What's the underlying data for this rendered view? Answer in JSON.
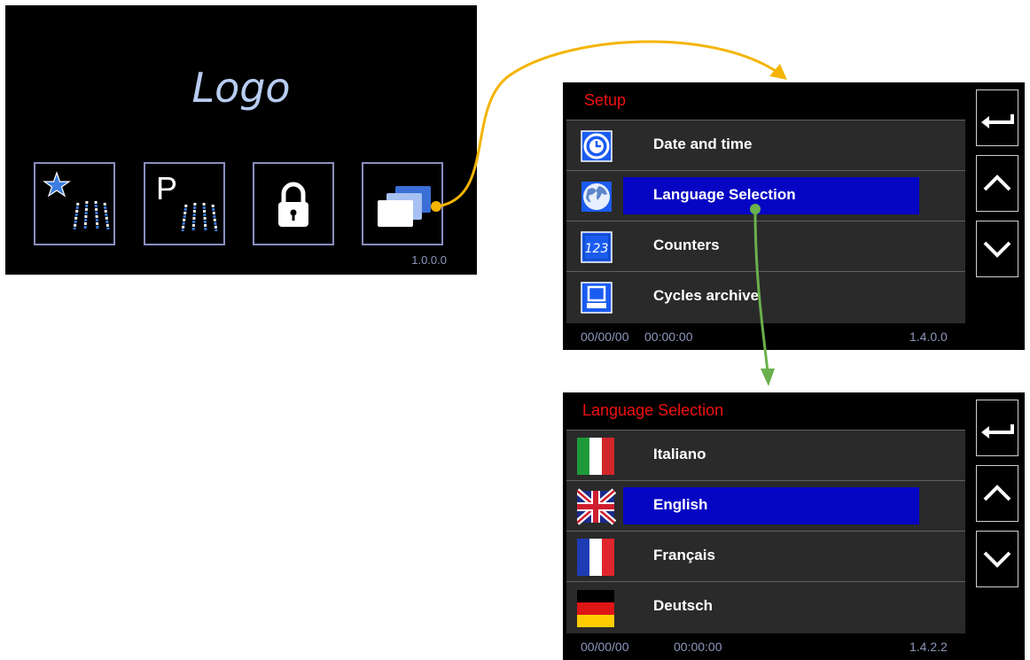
{
  "home": {
    "logo": "Logo",
    "version": "1.0.0.0",
    "buttons": [
      {
        "name": "star-wash-icon"
      },
      {
        "name": "program-wash-icon",
        "letter": "P"
      },
      {
        "name": "lock-icon"
      },
      {
        "name": "windows-stack-icon"
      }
    ]
  },
  "setup": {
    "title": "Setup",
    "items": [
      {
        "label": "Date and time",
        "icon": "clock-icon"
      },
      {
        "label": "Language Selection",
        "icon": "globe-icon",
        "selected": true
      },
      {
        "label": "Counters",
        "icon": "counter-icon",
        "icon_text": "123"
      },
      {
        "label": "Cycles archive",
        "icon": "archive-icon"
      }
    ],
    "date": "00/00/00",
    "time": "00:00:00",
    "version": "1.4.0.0"
  },
  "language": {
    "title": "Language Selection",
    "items": [
      {
        "label": "Italiano",
        "icon": "italy-flag-icon"
      },
      {
        "label": "English",
        "icon": "uk-flag-icon",
        "selected": true
      },
      {
        "label": "Français",
        "icon": "france-flag-icon"
      },
      {
        "label": "Deutsch",
        "icon": "germany-flag-icon"
      }
    ],
    "date": "00/00/00",
    "time": "00:00:00",
    "version": "1.4.2.2"
  },
  "nav": {
    "back": "back-arrow-icon",
    "up": "chevron-up-icon",
    "down": "chevron-down-icon"
  },
  "colors": {
    "title_red": "#ee1111",
    "highlight_blue": "#0605c4",
    "connector_yellow": "#f4b400",
    "connector_green": "#6ab04c",
    "icon_blue": "#1b5cf0"
  }
}
